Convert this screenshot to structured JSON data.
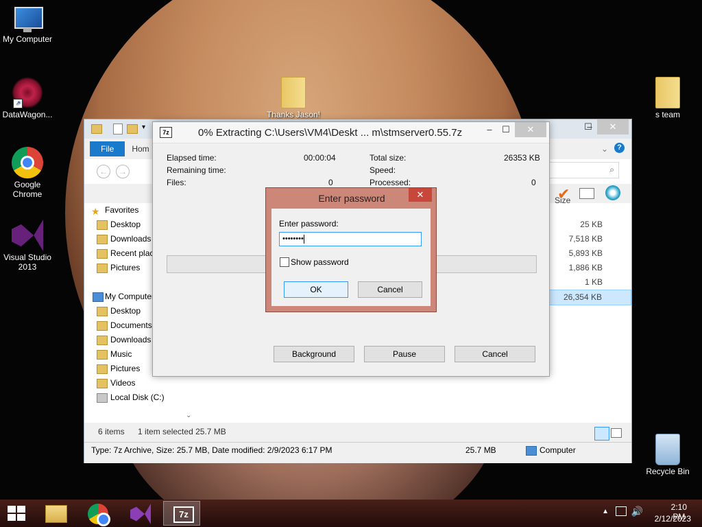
{
  "desktop": {
    "icons": [
      {
        "label": "My Computer",
        "icon": "computer-icon"
      },
      {
        "label": "DataWagon...",
        "icon": "datawagon-icon"
      },
      {
        "label": "Google\nChrome",
        "icon": "chrome-icon"
      },
      {
        "label": "Visual Studio\n2013",
        "icon": "visual-studio-icon"
      },
      {
        "label": "Thanks Jason!",
        "icon": "folder-icon"
      },
      {
        "label": "s team",
        "icon": "folder-icon"
      },
      {
        "label": "Recycle Bin",
        "icon": "recycle-bin-icon"
      }
    ]
  },
  "explorer": {
    "tab_file": "File",
    "tab_home": "Hom",
    "nav_items": [
      {
        "label": "Favorites",
        "icon": "star-icon"
      },
      {
        "label": "Desktop",
        "icon": "desktop-icon"
      },
      {
        "label": "Downloads",
        "icon": "downloads-icon"
      },
      {
        "label": "Recent places",
        "icon": "recent-icon"
      },
      {
        "label": "Pictures",
        "icon": "pictures-icon"
      },
      {
        "label": "My Computer",
        "icon": "computer-icon"
      },
      {
        "label": "Desktop",
        "icon": "desktop-icon"
      },
      {
        "label": "Documents",
        "icon": "documents-icon"
      },
      {
        "label": "Downloads",
        "icon": "downloads-icon"
      },
      {
        "label": "Music",
        "icon": "music-icon"
      },
      {
        "label": "Pictures",
        "icon": "pictures-icon"
      },
      {
        "label": "Videos",
        "icon": "videos-icon"
      },
      {
        "label": "Local Disk (C:)",
        "icon": "disk-icon"
      }
    ],
    "size_header": "Size",
    "sizes": [
      "25 KB",
      "7,518 KB",
      "5,893 KB",
      "1,886 KB",
      "1 KB",
      "26,354 KB"
    ],
    "item_count": "6 items",
    "selected_info": "1 item selected  25.7 MB",
    "details_text": "Type: 7z Archive, Size: 25.7 MB, Date modified: 2/9/2023 6:17 PM",
    "details_size": "25.7 MB",
    "details_location": "Computer"
  },
  "progress": {
    "title": "0% Extracting C:\\Users\\VM4\\Deskt ... m\\stmserver0.55.7z",
    "app_icon": "7z",
    "elapsed_label": "Elapsed time:",
    "elapsed_value": "00:00:04",
    "remaining_label": "Remaining time:",
    "files_label": "Files:",
    "files_value": "0",
    "total_label": "Total size:",
    "total_value": "26353 KB",
    "speed_label": "Speed:",
    "processed_label": "Processed:",
    "processed_value": "0",
    "percent": 0,
    "btn_background": "Background",
    "btn_pause": "Pause",
    "btn_cancel": "Cancel"
  },
  "password_dialog": {
    "title": "Enter password",
    "label": "Enter password:",
    "value": "••••••••",
    "show_password": "Show password",
    "show_checked": false,
    "ok": "OK",
    "cancel": "Cancel"
  },
  "taskbar": {
    "time": "2:10 PM",
    "date": "2/12/2023",
    "apps": [
      "file-explorer-icon",
      "chrome-icon",
      "visual-studio-icon",
      "7zip-icon"
    ],
    "active_app": "7zip-icon",
    "seven_zip_label": "7z"
  }
}
